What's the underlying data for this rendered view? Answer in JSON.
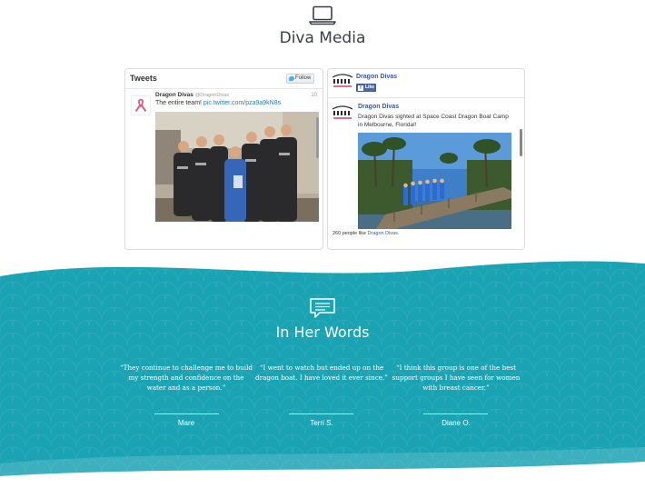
{
  "header": {
    "icon": "laptop-icon",
    "title": "Diva Media"
  },
  "twitter": {
    "heading": "Tweets",
    "follow_label": "Follow",
    "tweet": {
      "name": "Dragon Divas",
      "handle": "@DragonDivas",
      "time": "10",
      "text": "The entire team!",
      "link": "pic.twitter.com/pza9a9kN8s"
    }
  },
  "facebook": {
    "page_name": "Dragon Divas",
    "like_label": "Like",
    "post_author": "Dragon Divas",
    "post_text": "Dragon Divas sighted at Space Coast Dragon Boat Camp in Melbourne, Florida!!",
    "footer_prefix": "260 people like",
    "footer_link": "Dragon Divas."
  },
  "testimonials": {
    "icon": "speech-bubble-icon",
    "title": "In Her Words",
    "quotes": [
      {
        "text": "“They continue to challenge me to build my strength and confidence on the water and as a person.”",
        "name": "Mare"
      },
      {
        "text": "“I went to watch but ended up on the dragon boat. I have loved it ever since.”",
        "name": "Terri S."
      },
      {
        "text": "“I think this group is one of the best support groups I have seen for women with breast cancer.”",
        "name": "Diane O."
      }
    ]
  },
  "colors": {
    "teal": "#1aa3b3",
    "teal_light": "#28b0bf",
    "twitter_blue": "#2b7bb9",
    "facebook_blue": "#3b5998"
  }
}
